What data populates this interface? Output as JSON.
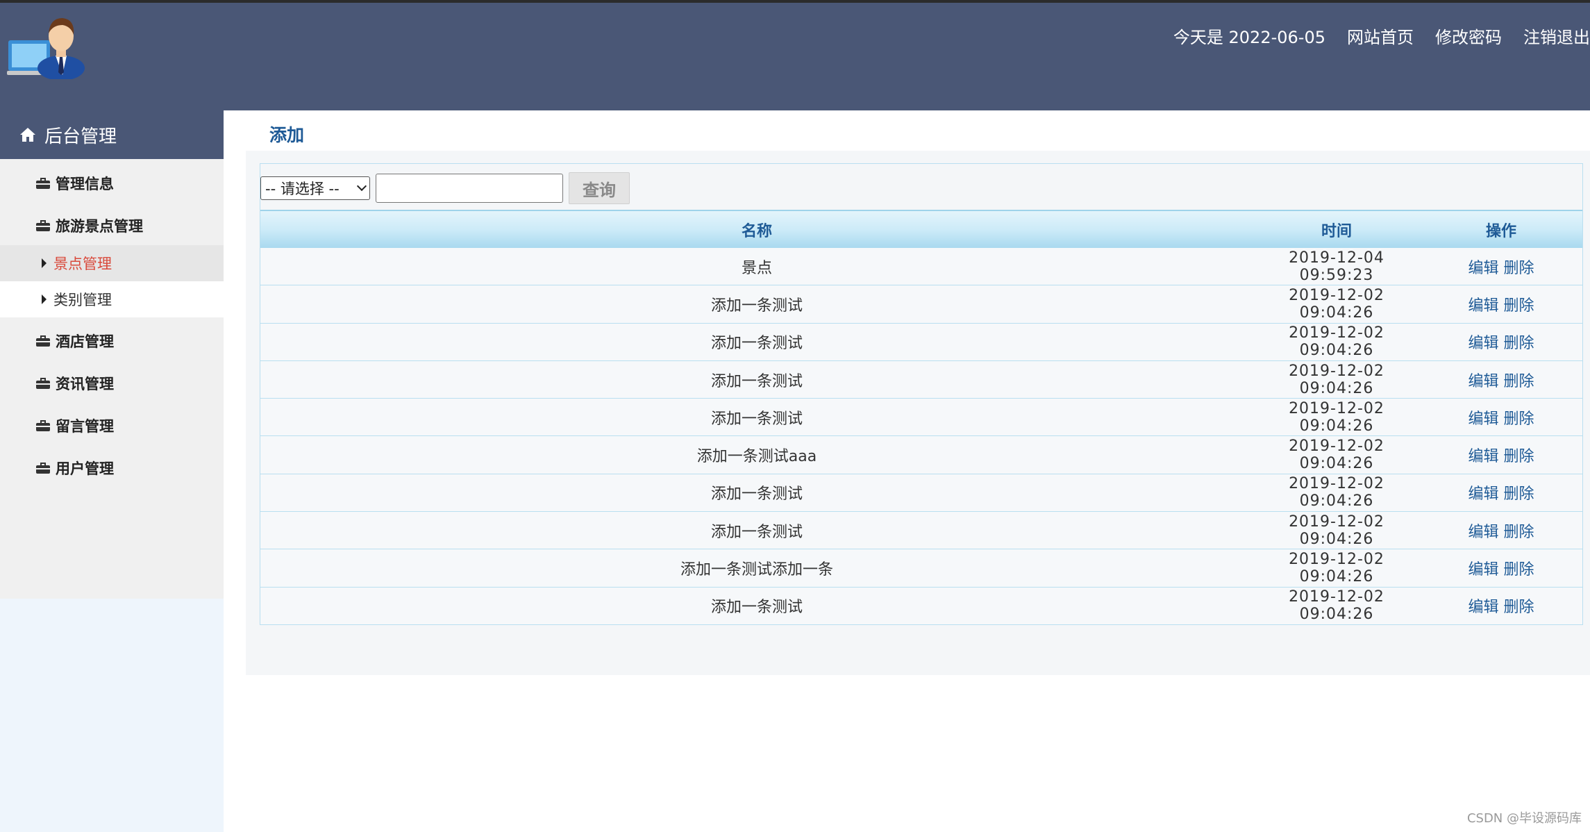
{
  "header": {
    "date_text": "今天是 2022-06-05",
    "nav": [
      "网站首页",
      "修改密码",
      "注销退出"
    ]
  },
  "sidebar": {
    "title": "后台管理",
    "groups": [
      {
        "label": "管理信息"
      },
      {
        "label": "旅游景点管理",
        "children": [
          {
            "label": "景点管理",
            "active": true
          },
          {
            "label": "类别管理"
          }
        ]
      },
      {
        "label": "酒店管理"
      },
      {
        "label": "资讯管理"
      },
      {
        "label": "留言管理"
      },
      {
        "label": "用户管理"
      }
    ]
  },
  "main": {
    "title": "添加",
    "search": {
      "select_value": "-- 请选择 --",
      "input_value": "",
      "button": "查询"
    },
    "table": {
      "headers": [
        "名称",
        "时间",
        "操作"
      ],
      "rows": [
        {
          "name": "景点",
          "time": "2019-12-04 09:59:23"
        },
        {
          "name": "添加一条测试",
          "time": "2019-12-02 09:04:26"
        },
        {
          "name": "添加一条测试",
          "time": "2019-12-02 09:04:26"
        },
        {
          "name": "添加一条测试",
          "time": "2019-12-02 09:04:26"
        },
        {
          "name": "添加一条测试",
          "time": "2019-12-02 09:04:26"
        },
        {
          "name": "添加一条测试aaa",
          "time": "2019-12-02 09:04:26"
        },
        {
          "name": "添加一条测试",
          "time": "2019-12-02 09:04:26"
        },
        {
          "name": "添加一条测试",
          "time": "2019-12-02 09:04:26"
        },
        {
          "name": "添加一条测试添加一条",
          "time": "2019-12-02 09:04:26"
        },
        {
          "name": "添加一条测试",
          "time": "2019-12-02 09:04:26"
        }
      ],
      "edit_label": "编辑",
      "delete_label": "删除"
    }
  },
  "watermark": "CSDN @毕设源码库",
  "colors": {
    "header_bg": "#4a5776",
    "active_menu": "#d9493b",
    "link": "#1e5a96",
    "table_border": "#b9dff0"
  }
}
